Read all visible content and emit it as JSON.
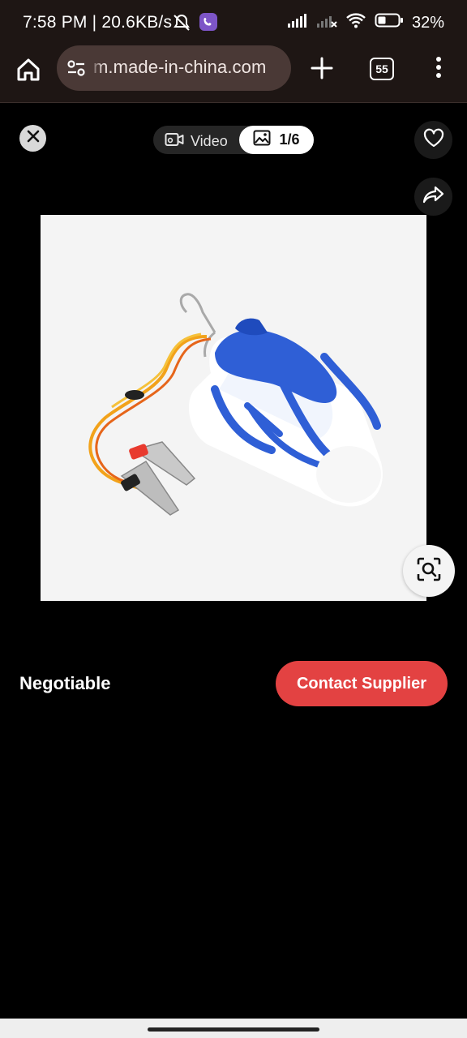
{
  "status_bar": {
    "time": "7:58 PM | 20.6KB/s",
    "battery_percent": "32%",
    "icons": [
      "alarm-off-icon",
      "viber-icon",
      "signal-icon",
      "signal-2-icon",
      "wifi-icon",
      "battery-icon"
    ]
  },
  "browser": {
    "url": "m.made-in-china.com",
    "tab_count": "55",
    "icons": [
      "home-icon",
      "site-settings-icon",
      "plus-icon",
      "tabs-icon",
      "overflow-menu-icon"
    ]
  },
  "media_viewer": {
    "video_label": "Video",
    "photo_counter": "1/6",
    "icons": [
      "close-icon",
      "video-icon",
      "image-icon",
      "heart-icon",
      "share-icon",
      "lens-search-icon"
    ]
  },
  "product": {
    "price": "Negotiable",
    "contact_label": "Contact Supplier",
    "image_subject": "blue hanging LED bulb with orange cable and alligator clips"
  },
  "colors": {
    "accent_red": "#e34242",
    "browser_bar": "#1e1614",
    "url_pill": "#4a3936"
  }
}
